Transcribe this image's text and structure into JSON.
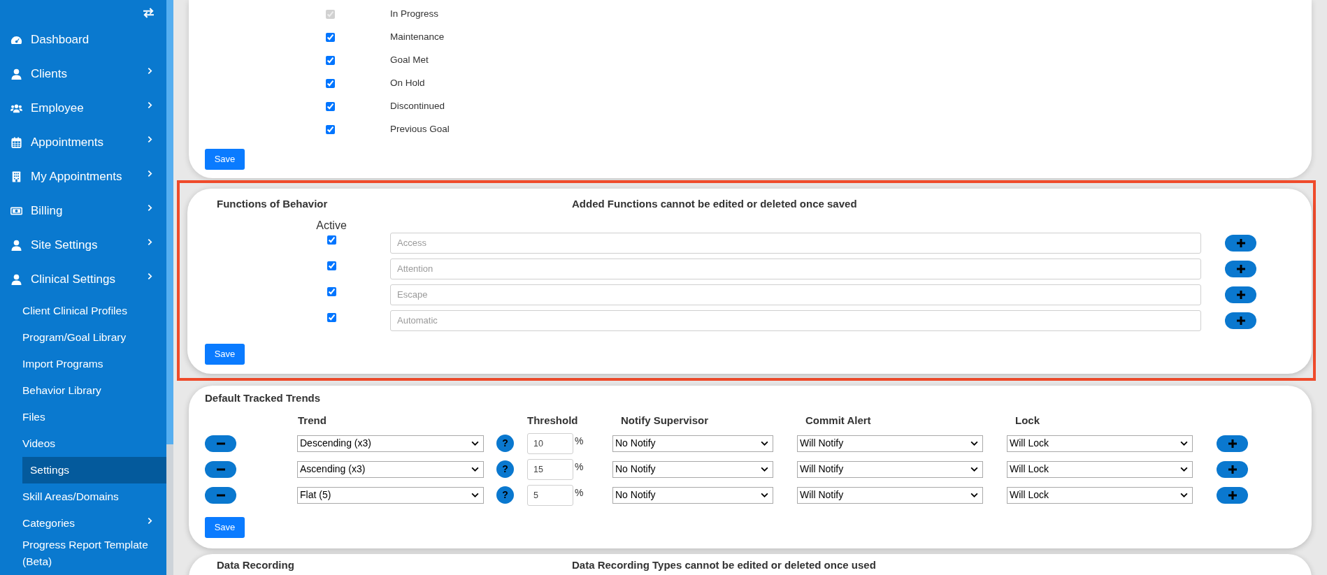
{
  "sidebar": {
    "items": [
      {
        "label": "Dashboard",
        "chevron": false
      },
      {
        "label": "Clients",
        "chevron": true
      },
      {
        "label": "Employee",
        "chevron": true
      },
      {
        "label": "Appointments",
        "chevron": true
      },
      {
        "label": "My Appointments",
        "chevron": true
      },
      {
        "label": "Billing",
        "chevron": true
      },
      {
        "label": "Site Settings",
        "chevron": true
      },
      {
        "label": "Clinical Settings",
        "chevron": true
      }
    ],
    "subitems": [
      {
        "label": "Client Clinical Profiles",
        "selected": false,
        "chevron": false
      },
      {
        "label": "Program/Goal Library",
        "selected": false,
        "chevron": false
      },
      {
        "label": "Import Programs",
        "selected": false,
        "chevron": false
      },
      {
        "label": "Behavior Library",
        "selected": false,
        "chevron": false
      },
      {
        "label": "Files",
        "selected": false,
        "chevron": false
      },
      {
        "label": "Videos",
        "selected": false,
        "chevron": false
      },
      {
        "label": "Settings",
        "selected": true,
        "chevron": false
      },
      {
        "label": "Skill Areas/Domains",
        "selected": false,
        "chevron": false
      },
      {
        "label": "Categories",
        "selected": false,
        "chevron": true
      },
      {
        "label": "Progress Report Template (Beta)",
        "selected": false,
        "chevron": false
      }
    ]
  },
  "statuses": {
    "rows": [
      {
        "label": "In Progress",
        "checked": true,
        "disabled": true
      },
      {
        "label": "Maintenance",
        "checked": true,
        "disabled": false
      },
      {
        "label": "Goal Met",
        "checked": true,
        "disabled": false
      },
      {
        "label": "On Hold",
        "checked": true,
        "disabled": false
      },
      {
        "label": "Discontinued",
        "checked": true,
        "disabled": false
      },
      {
        "label": "Previous Goal",
        "checked": true,
        "disabled": false
      }
    ],
    "save": "Save"
  },
  "functions": {
    "title": "Functions of Behavior",
    "notice": "Added Functions cannot be edited or deleted once saved",
    "active_label": "Active",
    "highlighted": true,
    "rows": [
      {
        "checked": true,
        "placeholder": "Access"
      },
      {
        "checked": true,
        "placeholder": "Attention"
      },
      {
        "checked": true,
        "placeholder": "Escape"
      },
      {
        "checked": true,
        "placeholder": "Automatic"
      }
    ],
    "save": "Save"
  },
  "trends": {
    "title": "Default Tracked Trends",
    "columns": [
      "Trend",
      "Threshold",
      "Notify Supervisor",
      "Commit Alert",
      "Lock"
    ],
    "rows": [
      {
        "trend": "Descending (x3)",
        "help": "?",
        "threshold": "10",
        "unit": "%",
        "notify": "No Notify",
        "commit": "Will Notify",
        "lock": "Will Lock"
      },
      {
        "trend": "Ascending (x3)",
        "help": "?",
        "threshold": "15",
        "unit": "%",
        "notify": "No Notify",
        "commit": "Will Notify",
        "lock": "Will Lock"
      },
      {
        "trend": "Flat (5)",
        "help": "?",
        "threshold": "5",
        "unit": "%",
        "notify": "No Notify",
        "commit": "Will Notify",
        "lock": "Will Lock"
      }
    ],
    "save": "Save"
  },
  "data_recording": {
    "title": "Data Recording",
    "notice": "Data Recording Types cannot be edited or deleted once used"
  }
}
